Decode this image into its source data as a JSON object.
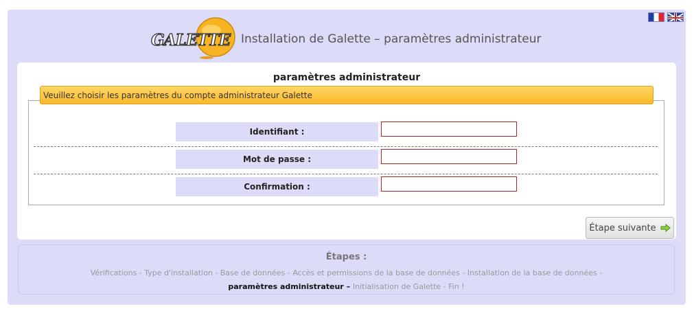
{
  "header": {
    "title": "Installation de Galette – paramètres administrateur",
    "logo_text": "GALETTE",
    "languages": [
      "fr",
      "en"
    ]
  },
  "form": {
    "title": "paramètres administrateur",
    "legend": "Veuillez choisir les paramètres du compte administrateur Galette",
    "fields": [
      {
        "label": "Identifiant :",
        "value": ""
      },
      {
        "label": "Mot de passe :",
        "value": ""
      },
      {
        "label": "Confirmation :",
        "value": ""
      }
    ],
    "next_label": "Étape suivante",
    "next_icon": "arrow-right-icon"
  },
  "steps": {
    "title": "Étapes :",
    "items": [
      "Vérifications",
      "Type d'installation",
      "Base de données",
      "Accès et permissions de la base de données",
      "Installation de la base de données",
      "paramètres administrateur",
      "Initialisation de Galette",
      "Fin !"
    ],
    "current_index": 5
  },
  "colors": {
    "background": "#dcdcf8",
    "legend": "#f9b92a",
    "required": "#e00000"
  }
}
